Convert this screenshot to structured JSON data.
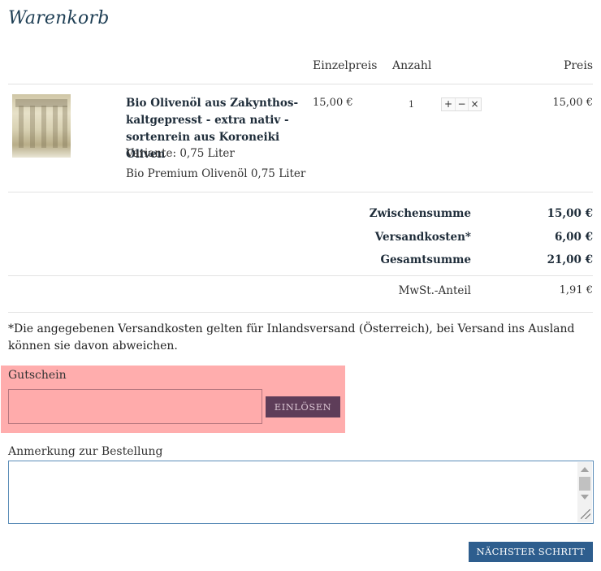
{
  "page": {
    "title": "Warenkorb"
  },
  "table": {
    "headers": {
      "unit_price": "Einzelpreis",
      "quantity": "Anzahl",
      "price": "Preis"
    },
    "item": {
      "name": "Bio Olivenöl aus Zakynthos- kaltgepresst - extra nativ - sortenrein aus Koroneiki Oliven",
      "variant": "Variante: 0,75 Liter",
      "description": "Bio Premium Olivenöl 0,75 Liter",
      "unit_price": "15,00 €",
      "quantity": "1",
      "qty_plus": "+",
      "qty_minus": "−",
      "qty_remove": "×",
      "total": "15,00 €",
      "image_icon": "product-image"
    }
  },
  "summary": {
    "subtotal_label": "Zwischensumme",
    "subtotal": "15,00 €",
    "shipping_label": "Versandkosten*",
    "shipping": "6,00 €",
    "total_label": "Gesamtsumme",
    "total": "21,00 €",
    "tax_label": "MwSt.-Anteil",
    "tax": "1,91 €"
  },
  "shipping_note": "*Die angegebenen Versandkosten gelten für Inlandsversand (Österreich), bei Versand ins Ausland können sie davon abweichen.",
  "voucher": {
    "label": "Gutschein",
    "input_value": "",
    "button": "EINLÖSEN",
    "highlight_color": "#ffadad"
  },
  "remark": {
    "label": "Anmerkung zur Bestellung",
    "value": ""
  },
  "actions": {
    "next": "NÄCHSTER SCHRITT",
    "next_color": "#2e5e8e"
  }
}
